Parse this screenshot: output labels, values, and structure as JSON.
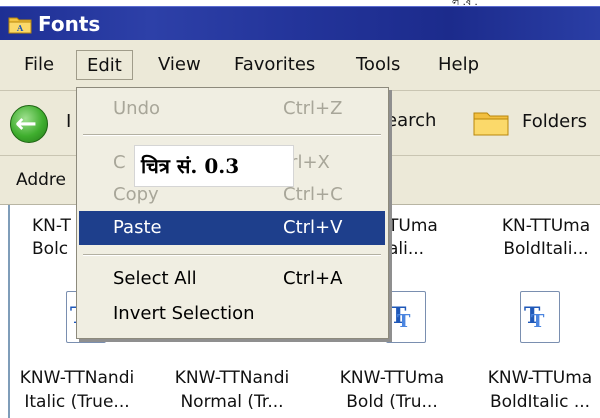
{
  "window": {
    "title": "Fonts",
    "top_mark": "ল .ষ ."
  },
  "menubar": {
    "items": [
      "File",
      "Edit",
      "View",
      "Favorites",
      "Tools",
      "Help"
    ]
  },
  "toolbar": {
    "back_label": "I",
    "search_label": "earch",
    "folders_label": "Folders"
  },
  "addressbar": {
    "label": "Addre"
  },
  "edit_menu": {
    "undo": {
      "label": "Undo",
      "shortcut": "Ctrl+Z"
    },
    "cut": {
      "label": "C",
      "shortcut": "trl+X"
    },
    "copy": {
      "label": "Copy",
      "shortcut": "Ctrl+C"
    },
    "paste": {
      "label": "Paste",
      "shortcut": "Ctrl+V"
    },
    "select_all": {
      "label": "Select All",
      "shortcut": "Ctrl+A"
    },
    "invert_selection": {
      "label": "Invert Selection"
    }
  },
  "caption": "चित्र सं. 0.3",
  "files": {
    "row1": [
      {
        "line1": "KN-T",
        "line2": "Bolc"
      },
      {
        "line1": "TUma",
        "line2": "ali..."
      },
      {
        "line1": "KN-TTUma",
        "line2": "BoldItali..."
      }
    ],
    "row2": [
      {
        "line1": "KNW-TTNandi",
        "line2": "Italic (True..."
      },
      {
        "line1": "KNW-TTNandi",
        "line2": "Normal (Tr..."
      },
      {
        "line1": "KNW-TTUma",
        "line2": "Bold (Tru..."
      },
      {
        "line1": "KNW-TTUma",
        "line2": "BoldItalic ..."
      }
    ]
  },
  "colors": {
    "titlebar": "#23349a",
    "menu_highlight": "#1e3f8c",
    "chrome": "#ece9d8"
  }
}
